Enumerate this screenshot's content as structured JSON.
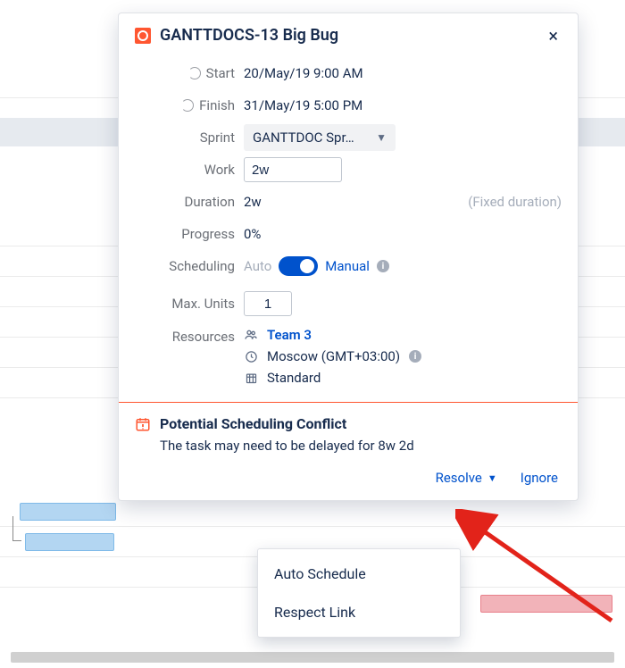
{
  "panel": {
    "title": "GANTTDOCS-13 Big Bug",
    "close_glyph": "×"
  },
  "fields": {
    "start": {
      "label": "Start",
      "value": "20/May/19 9:00 AM"
    },
    "finish": {
      "label": "Finish",
      "value": "31/May/19 5:00 PM"
    },
    "sprint": {
      "label": "Sprint",
      "selected": "GANTTDOC Spr…"
    },
    "work": {
      "label": "Work",
      "value": "2w"
    },
    "duration": {
      "label": "Duration",
      "value": "2w",
      "note": "(Fixed duration)"
    },
    "progress": {
      "label": "Progress",
      "value": "0%"
    },
    "scheduling": {
      "label": "Scheduling",
      "auto": "Auto",
      "manual": "Manual"
    },
    "maxunits": {
      "label": "Max. Units",
      "value": "1"
    },
    "resources": {
      "label": "Resources",
      "team": "Team 3",
      "tz": "Moscow (GMT+03:00)",
      "cal": "Standard"
    }
  },
  "conflict": {
    "title": "Potential Scheduling Conflict",
    "message": "The task may need to be delayed for 8w 2d",
    "resolve": "Resolve",
    "ignore": "Ignore"
  },
  "menu": {
    "auto": "Auto Schedule",
    "respect": "Respect Link"
  }
}
